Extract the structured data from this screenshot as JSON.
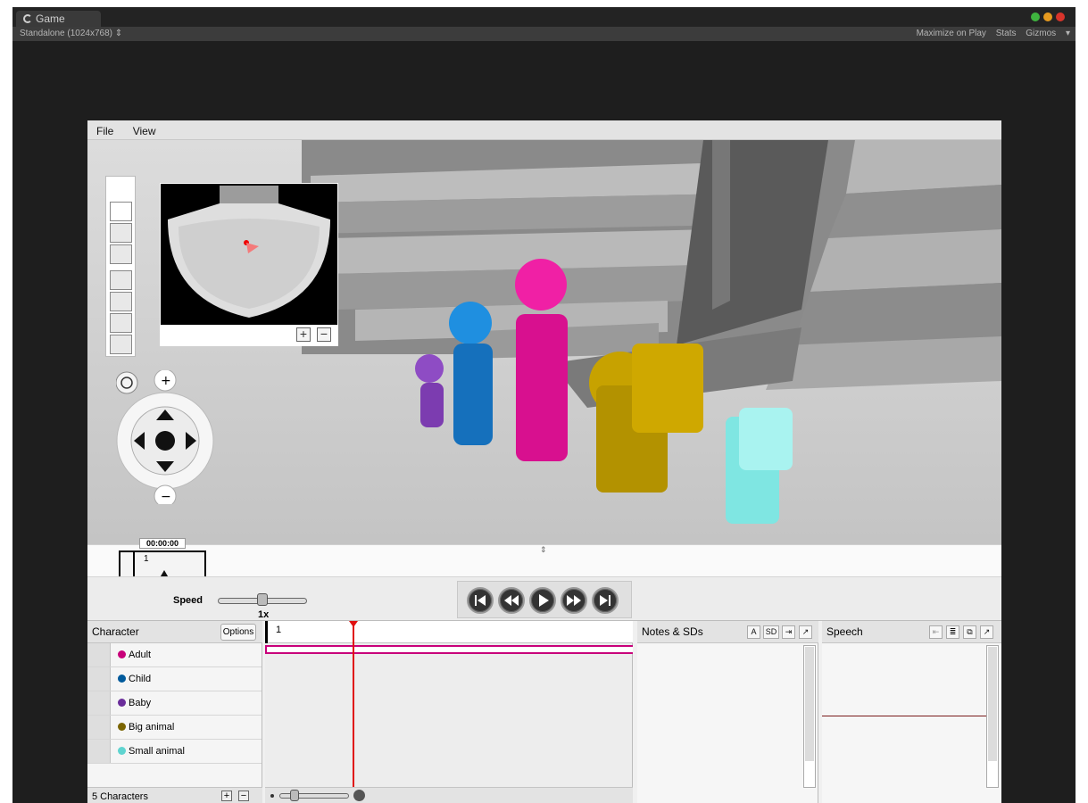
{
  "editor": {
    "tab_label": "Game",
    "resolution": "Standalone (1024x768)",
    "maximize_label": "Maximize on Play",
    "stats_label": "Stats",
    "gizmos_label": "Gizmos"
  },
  "menu": {
    "file": "File",
    "view": "View"
  },
  "scrubber": {
    "time": "00:00:00",
    "frame": "1"
  },
  "playback": {
    "speed_label": "Speed",
    "speed_value": "1x"
  },
  "characters": {
    "header": "Character",
    "options_label": "Options",
    "items": [
      {
        "name": "Adult",
        "color": "#c8007a"
      },
      {
        "name": "Child",
        "color": "#005a9c"
      },
      {
        "name": "Baby",
        "color": "#6a2d9a"
      },
      {
        "name": "Big animal",
        "color": "#7a6400"
      },
      {
        "name": "Small animal",
        "color": "#5fd4d0"
      }
    ],
    "footer": "5 Characters"
  },
  "timeline": {
    "frame": "1"
  },
  "notes": {
    "header": "Notes & SDs",
    "btn_a": "A",
    "btn_sd": "SD"
  },
  "speech": {
    "header": "Speech"
  }
}
